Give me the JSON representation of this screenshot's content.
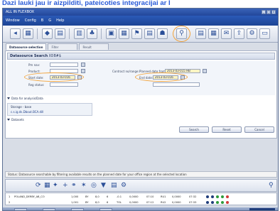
{
  "headline": "Dazi lauki jau ir aizpilditi, pateicoties integracijai ar I",
  "window": {
    "title": "ALL IN FLEXBOX"
  },
  "menu": [
    "Window",
    "Config",
    "B",
    "G",
    "Help"
  ],
  "tabs": [
    "Datasource selection",
    "Filter",
    "Result"
  ],
  "section": {
    "title": "Datasource Search",
    "code": "XDB#$"
  },
  "form": {
    "labels": {
      "pm": "Pm nav:",
      "product": "Product:",
      "start": "Start date:",
      "contract": "Contract no/range:",
      "planned": "Planned date from:",
      "end": "End date:",
      "reg": "Reg status:"
    },
    "values": {
      "planned": "2013-03-015 HB",
      "start": "2013-03-016",
      "end": "2013-03-016"
    }
  },
  "subsections": [
    "Data for analysis/Data",
    "Datasets"
  ],
  "datasource": {
    "head": "Storage - base",
    "row": "c.s.ig.ds.Dbout.BCA.dill"
  },
  "buttons": [
    "Search",
    "Reset",
    "Cancel"
  ],
  "status": "Status: Datasource searchable by filtering available results on the planned date for your office region at the selected location",
  "grid": {
    "rows": [
      [
        "1",
        "POLAND_DERBY_AB_CO",
        "1,000",
        "BY",
        "8,0",
        "6",
        "-0.1",
        "0,0000",
        "07:10",
        "RU1",
        "0,0000",
        "07:32"
      ],
      [
        "2",
        "",
        "1,001",
        "BY",
        "8,0",
        "6",
        "TOL",
        "0,0000",
        "07:12",
        "RU2",
        "0,0000",
        "07:33"
      ]
    ]
  },
  "colors": {
    "accent": "#2a5bd7",
    "highlight": "#f2a33a",
    "titlebar": "#22479a"
  }
}
